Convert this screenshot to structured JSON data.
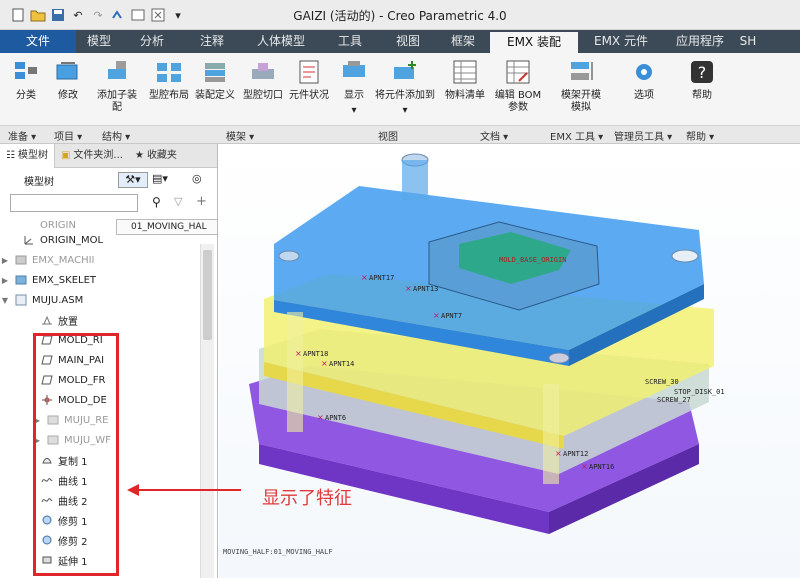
{
  "window": {
    "title": "GAIZI (活动的) - Creo Parametric 4.0"
  },
  "tabs": [
    {
      "label": "文件"
    },
    {
      "label": "模型"
    },
    {
      "label": "分析"
    },
    {
      "label": "注释"
    },
    {
      "label": "人体模型"
    },
    {
      "label": "工具"
    },
    {
      "label": "视图"
    },
    {
      "label": "框架"
    },
    {
      "label": "EMX 装配"
    },
    {
      "label": "EMX 元件"
    },
    {
      "label": "应用程序"
    },
    {
      "label": "SH"
    }
  ],
  "ribbon": {
    "buttons": [
      {
        "label": "分类"
      },
      {
        "label": "修改"
      },
      {
        "label": "添加子装\n配"
      },
      {
        "label": "型腔布局"
      },
      {
        "label": "装配定义"
      },
      {
        "label": "型腔切口"
      },
      {
        "label": "元件状况"
      },
      {
        "label": "显示"
      },
      {
        "label": "将元件添加到"
      },
      {
        "label": "物料清单"
      },
      {
        "label": "编辑 BOM\n参数"
      },
      {
        "label": "模架开模\n模拟"
      },
      {
        "label": "选项"
      },
      {
        "label": "帮助"
      }
    ],
    "groups": [
      {
        "label": "准备 ▾"
      },
      {
        "label": "项目 ▾"
      },
      {
        "label": "结构 ▾"
      },
      {
        "label": "模架 ▾"
      },
      {
        "label": "视图"
      },
      {
        "label": "文档 ▾"
      },
      {
        "label": "EMX 工具 ▾"
      },
      {
        "label": "管理员工具 ▾"
      },
      {
        "label": "帮助 ▾"
      }
    ]
  },
  "left_panel": {
    "tabs": [
      {
        "label": "模型树"
      },
      {
        "label": "文件夹浏..."
      },
      {
        "label": "收藏夹"
      }
    ],
    "tree_title": "模型树",
    "column_header": "01_MOVING_HAL",
    "nodes": [
      {
        "label": "ORIGIN",
        "grey": true
      },
      {
        "label": "ORIGIN_MOL",
        "grey": false
      },
      {
        "label": "EMX_MACHII",
        "grey": true
      },
      {
        "label": "EMX_SKELET",
        "grey": false
      },
      {
        "label": "MUJU.ASM",
        "grey": false
      },
      {
        "label": "放置",
        "grey": false
      },
      {
        "label": "MOLD_RI",
        "grey": false
      },
      {
        "label": "MAIN_PAI",
        "grey": false
      },
      {
        "label": "MOLD_FR",
        "grey": false
      },
      {
        "label": "MOLD_DE",
        "grey": false
      },
      {
        "label": "MUJU_RE",
        "grey": true
      },
      {
        "label": "MUJU_WF",
        "grey": true
      },
      {
        "label": "复制 1",
        "grey": false
      },
      {
        "label": "曲线 1",
        "grey": false
      },
      {
        "label": "曲线 2",
        "grey": false
      },
      {
        "label": "修剪 1",
        "grey": false
      },
      {
        "label": "修剪 2",
        "grey": false
      },
      {
        "label": "延伸 1",
        "grey": false
      }
    ]
  },
  "viewport": {
    "labels": {
      "apnt17a": "APNT17",
      "apnt13": "APNT13",
      "apnt7": "APNT7",
      "apnt18": "APNT18",
      "apnt14": "APNT14",
      "apnt6": "APNT6",
      "apnt12": "APNT12",
      "apnt16": "APNT16",
      "screw": "SCREW_30",
      "screw2": "SCREW_27",
      "stop": "STOP_DISK_01",
      "origin": "MOLD_BASE_ORIGIN",
      "bottom": "MOVING_HALF:01_MOVING_HALF"
    }
  },
  "annotation": {
    "text": "显示了特征"
  },
  "colors": {
    "accent": "#1e5aa0",
    "tabbar": "#3c4a57",
    "highlight": "#e0262a"
  }
}
